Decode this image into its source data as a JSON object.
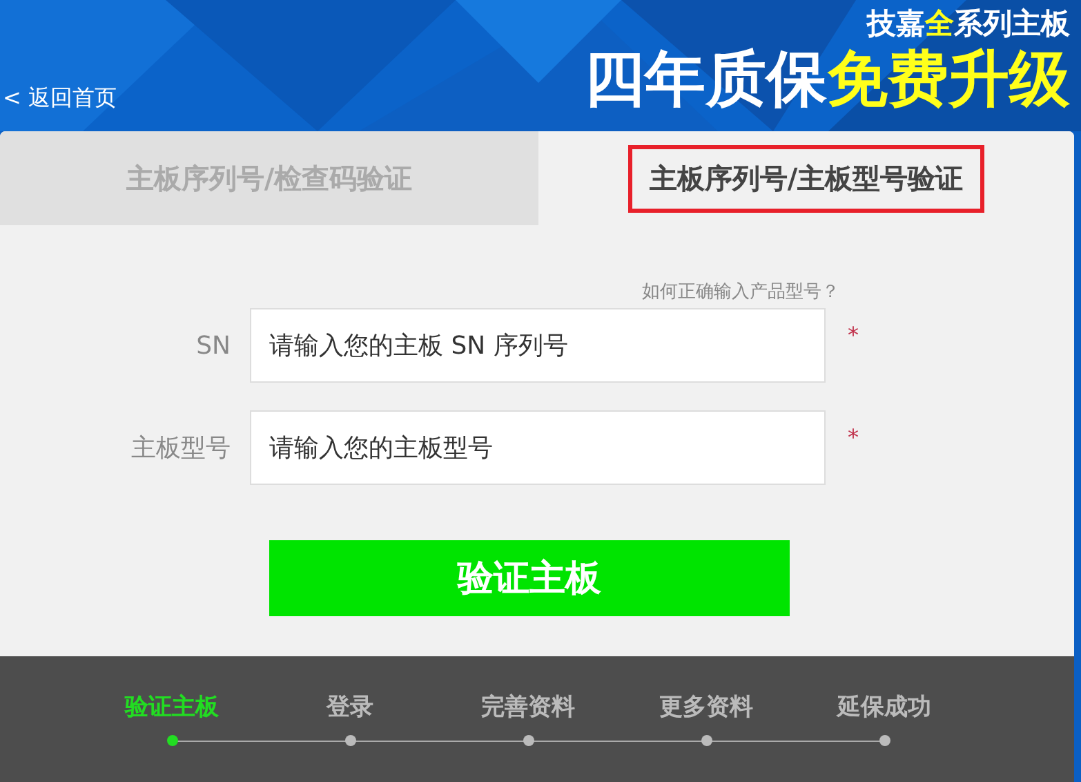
{
  "banner": {
    "back_link": "< 返回首页",
    "tagline": [
      {
        "text": "技嘉",
        "highlight": false
      },
      {
        "text": "全",
        "highlight": true
      },
      {
        "text": "系列主板",
        "highlight": false
      }
    ],
    "headline": [
      {
        "text": "四年质保",
        "highlight": false
      },
      {
        "text": "免费升级",
        "highlight": true
      }
    ]
  },
  "tabs": [
    {
      "label": "主板序列号/检查码验证",
      "selected": false
    },
    {
      "label": "主板序列号/主板型号验证",
      "selected": true
    }
  ],
  "help_link": "如何正确输入产品型号？",
  "fields": [
    {
      "label": "SN",
      "placeholder": "请输入您的主板 SN 序列号",
      "required_mark": "*"
    },
    {
      "label": "主板型号",
      "placeholder": "请输入您的主板型号",
      "required_mark": "*"
    }
  ],
  "submit_button": "验证主板",
  "steps": [
    {
      "label": "验证主板",
      "selected": true
    },
    {
      "label": "登录",
      "selected": false
    },
    {
      "label": "完善资料",
      "selected": false
    },
    {
      "label": "更多资料",
      "selected": false
    },
    {
      "label": "延保成功",
      "selected": false
    }
  ]
}
